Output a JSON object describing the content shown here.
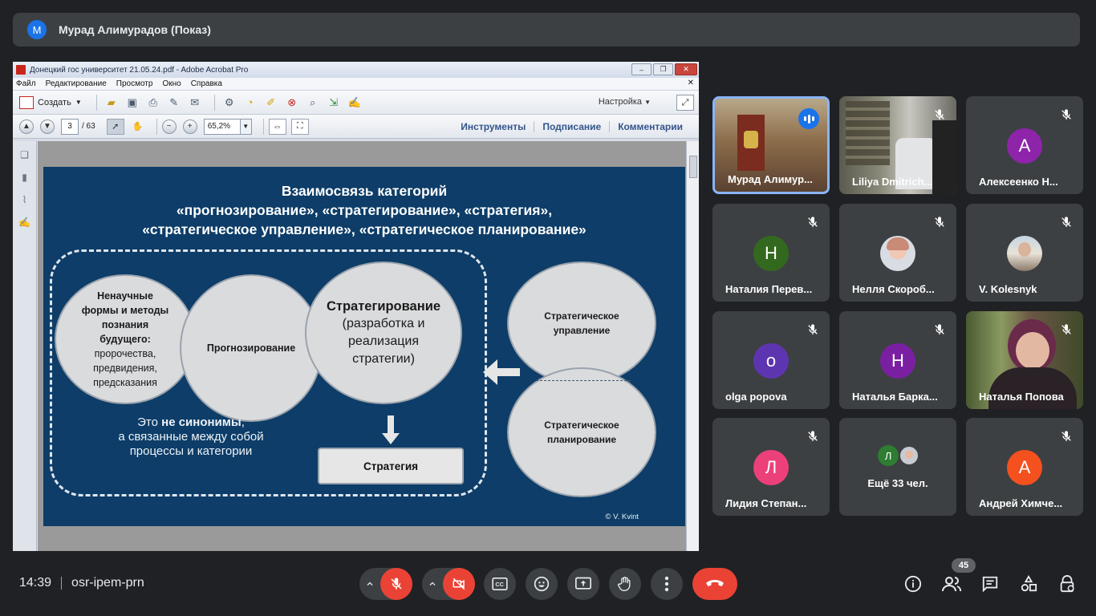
{
  "presenter_banner": {
    "avatar_letter": "М",
    "name": "Мурад Алимурадов (Показ)"
  },
  "acrobat": {
    "window_title": "Донецкий гос университет 21.05.24.pdf - Adobe Acrobat Pro",
    "menu": [
      "Файл",
      "Редактирование",
      "Просмотр",
      "Окно",
      "Справка"
    ],
    "create_label": "Создать",
    "settings_label": "Настройка",
    "page_current": "3",
    "page_total": "/ 63",
    "zoom": "65,2%",
    "panel_links": [
      "Инструменты",
      "Подписание",
      "Комментарии"
    ]
  },
  "slide": {
    "title_line1": "Взаимосвязь категорий",
    "title_line2": "«прогнозирование», «стратегирование», «стратегия»,",
    "title_line3": "«стратегическое управление», «стратегическое планирование»",
    "c1_bold1": "Ненаучные",
    "c1_bold2": "формы и методы",
    "c1_bold3": "познания",
    "c1_bold4": "будущего:",
    "c1_line5": "пророчества,",
    "c1_line6": "предвидения,",
    "c1_line7": "предсказания",
    "c2": "Прогнозирование",
    "c3_title": "Стратегирование",
    "c3_line2": "(разработка и",
    "c3_line3": "реализация",
    "c3_line4": "стратегии)",
    "c4_line1": "Стратегическое",
    "c4_line2": "управление",
    "c5_line1": "Стратегическое",
    "c5_line2": "планирование",
    "note_prefix": "Это ",
    "note_bold": "не синонимы",
    "note_suffix": ",",
    "note_line2": "а связанные между собой",
    "note_line3": "процессы и категории",
    "strategy_box": "Стратегия",
    "copyright": "© V. Kvint"
  },
  "participants": [
    {
      "name": "Мурад Алимур...",
      "type": "video",
      "speaking": true
    },
    {
      "name": "Liliya Dmitrich...",
      "type": "video",
      "muted": true
    },
    {
      "name": "Алексеенко Н...",
      "type": "letter",
      "letter": "А",
      "color": "#8e24aa",
      "muted": true
    },
    {
      "name": "Наталия Перев...",
      "type": "letter",
      "letter": "Н",
      "color": "#33691e",
      "muted": true
    },
    {
      "name": "Нелля Скороб...",
      "type": "photo",
      "muted": true
    },
    {
      "name": "V. Kolesnyk",
      "type": "photo",
      "muted": true
    },
    {
      "name": "olga popova",
      "type": "letter",
      "letter": "o",
      "color": "#5e35b1",
      "muted": true
    },
    {
      "name": "Наталья Барка...",
      "type": "letter",
      "letter": "Н",
      "color": "#7b1fa2",
      "muted": true
    },
    {
      "name": "Наталья Попова",
      "type": "video",
      "muted": true
    },
    {
      "name": "Лидия Степан...",
      "type": "letter",
      "letter": "Л",
      "color": "#ec407a",
      "muted": true
    },
    {
      "name": "Ещё 33 чел.",
      "type": "more",
      "letter": "Л"
    },
    {
      "name": "Андрей Химче...",
      "type": "letter",
      "letter": "А",
      "color": "#f4511e",
      "muted": true
    }
  ],
  "bottom_bar": {
    "time": "14:39",
    "meeting_code": "osr-ipem-prn",
    "participant_count": "45",
    "colors": {
      "end_call": "#ea4335",
      "muted_red": "#ea4335",
      "control_bg": "#3c4043"
    }
  }
}
